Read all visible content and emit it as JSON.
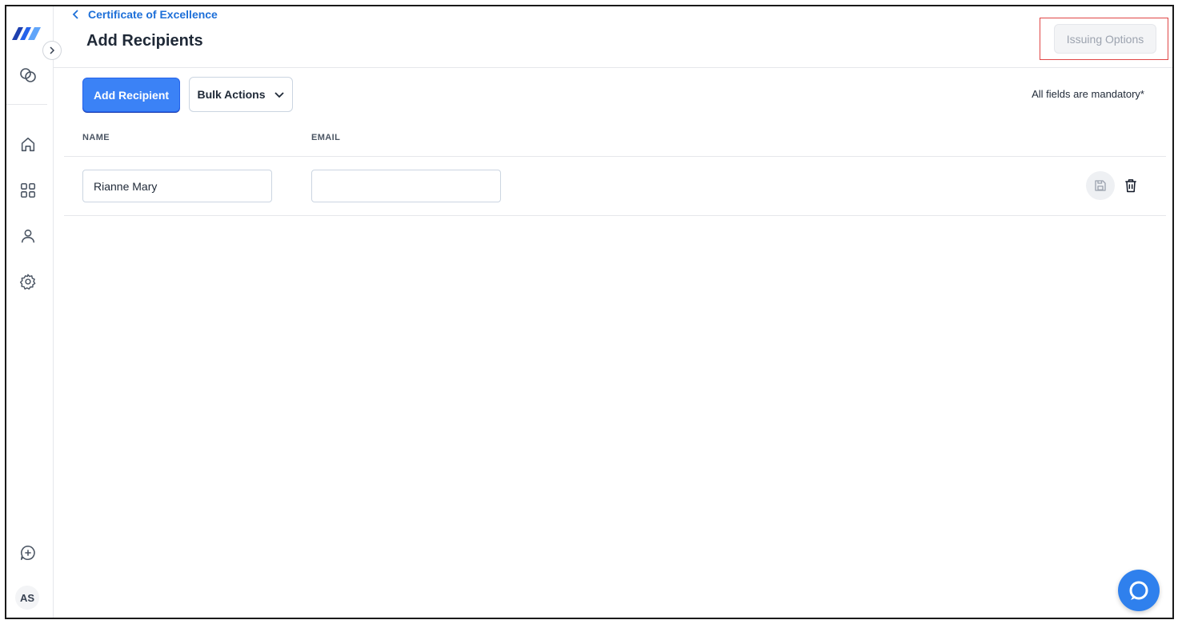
{
  "breadcrumb": {
    "label": "Certificate of Excellence"
  },
  "header": {
    "title": "Add Recipients",
    "issuing_options_label": "Issuing Options"
  },
  "toolbar": {
    "add_recipient_label": "Add Recipient",
    "bulk_actions_label": "Bulk Actions",
    "mandatory_note": "All fields are mandatory*"
  },
  "table": {
    "columns": [
      "NAME",
      "EMAIL"
    ],
    "rows": [
      {
        "name": "Rianne Mary",
        "email": ""
      }
    ]
  },
  "sidebar": {
    "icons": [
      "logo",
      "integrations-icon",
      "home-icon",
      "grid-icon",
      "user-icon",
      "settings-icon",
      "feedback-icon"
    ],
    "avatar_initials": "AS"
  },
  "colors": {
    "accent": "#3b82f6",
    "link": "#1d6fd8",
    "highlight": "#e04646"
  }
}
